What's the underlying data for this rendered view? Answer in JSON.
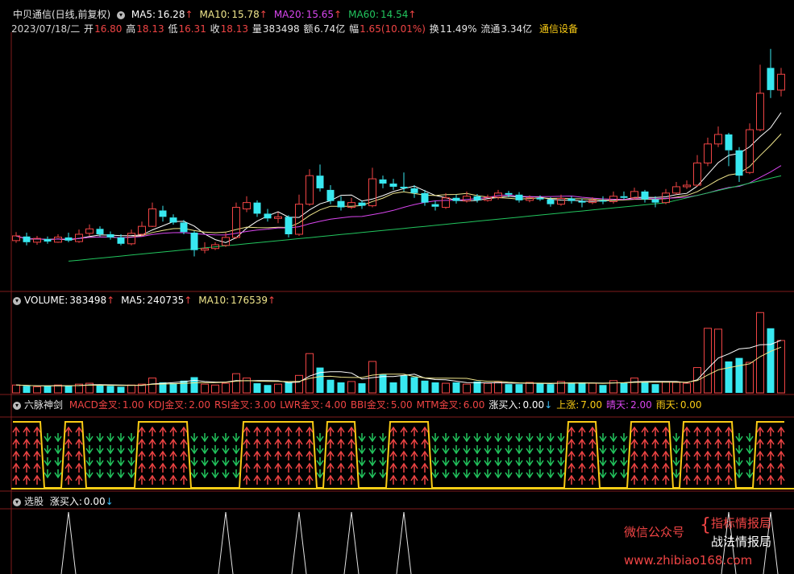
{
  "price_panel": {
    "title": "中贝通信(日线,前复权)",
    "ma": [
      {
        "label": "MA5:",
        "value": "16.28",
        "arrow": "↑",
        "color": "#ffffff"
      },
      {
        "label": "MA10:",
        "value": "15.78",
        "arrow": "↑",
        "color": "#f0e68c"
      },
      {
        "label": "MA20:",
        "value": "15.65",
        "arrow": "↑",
        "color": "#d946ef"
      },
      {
        "label": "MA60:",
        "value": "14.54",
        "arrow": "↑",
        "color": "#22c55e"
      }
    ],
    "info": {
      "date": "2023/07/18/二",
      "open_label": "开",
      "open": "16.80",
      "high_label": "高",
      "high": "18.13",
      "low_label": "低",
      "low": "16.31",
      "close_label": "收",
      "close": "18.13",
      "vol_label": "量",
      "vol": "383498",
      "amt_label": "额",
      "amt": "6.74亿",
      "chg_label": "幅",
      "chg": "1.65(10.01%)",
      "turn_label": "换",
      "turn": "11.49%",
      "float_label": "流通",
      "float": "3.34亿",
      "sector": "通信设备"
    }
  },
  "volume_panel": {
    "items": [
      {
        "label": "VOLUME:",
        "value": "383498",
        "arrow": "↑",
        "color": "#ffffff"
      },
      {
        "label": "MA5:",
        "value": "240735",
        "arrow": "↑",
        "color": "#ffffff"
      },
      {
        "label": "MA10:",
        "value": "176539",
        "arrow": "↑",
        "color": "#f0e68c"
      }
    ]
  },
  "indicator_panel": {
    "name": "六脉神剑",
    "items": [
      {
        "label": "MACD金叉:",
        "value": "1.00",
        "color": "#ef4444"
      },
      {
        "label": "KDJ金叉:",
        "value": "2.00",
        "color": "#ef4444"
      },
      {
        "label": "RSI金叉:",
        "value": "3.00",
        "color": "#ef4444"
      },
      {
        "label": "LWR金叉:",
        "value": "4.00",
        "color": "#ef4444"
      },
      {
        "label": "BBI金叉:",
        "value": "5.00",
        "color": "#ef4444"
      },
      {
        "label": "MTM金叉:",
        "value": "6.00",
        "color": "#ef4444"
      },
      {
        "label": "涨买入:",
        "value": "0.00",
        "arrow": "↓",
        "color": "#ffffff"
      },
      {
        "label": "上涨:",
        "value": "7.00",
        "color": "#facc15"
      },
      {
        "label": "晴天:",
        "value": "2.00",
        "color": "#d946ef"
      },
      {
        "label": "雨天:",
        "value": "0.00",
        "color": "#facc15"
      }
    ]
  },
  "select_panel": {
    "name": "选股",
    "items": [
      {
        "label": "涨买入:",
        "value": "0.00",
        "arrow": "↓",
        "color": "#ffffff"
      }
    ]
  },
  "watermark": {
    "line1": "微信公众号",
    "brand1": "指标情报局",
    "brand2": "战法情报局",
    "url": "www.zhibiao168.com"
  },
  "chart_data": {
    "type": "candlestick",
    "n_bars": 74,
    "candles": [
      {
        "o": 15.35,
        "c": 15.5,
        "h": 15.62,
        "l": 15.28
      },
      {
        "o": 15.48,
        "c": 15.3,
        "h": 15.6,
        "l": 15.2
      },
      {
        "o": 15.3,
        "c": 15.42,
        "h": 15.5,
        "l": 15.22
      },
      {
        "o": 15.4,
        "c": 15.32,
        "h": 15.48,
        "l": 15.25
      },
      {
        "o": 15.3,
        "c": 15.46,
        "h": 15.55,
        "l": 15.28
      },
      {
        "o": 15.45,
        "c": 15.35,
        "h": 15.6,
        "l": 15.3
      },
      {
        "o": 15.32,
        "c": 15.55,
        "h": 15.7,
        "l": 15.28
      },
      {
        "o": 15.58,
        "c": 15.72,
        "h": 15.86,
        "l": 15.5
      },
      {
        "o": 15.72,
        "c": 15.55,
        "h": 15.8,
        "l": 15.48
      },
      {
        "o": 15.55,
        "c": 15.45,
        "h": 15.64,
        "l": 15.38
      },
      {
        "o": 15.45,
        "c": 15.25,
        "h": 15.55,
        "l": 15.2
      },
      {
        "o": 15.25,
        "c": 15.58,
        "h": 15.7,
        "l": 15.2
      },
      {
        "o": 15.55,
        "c": 15.8,
        "h": 15.95,
        "l": 15.5
      },
      {
        "o": 15.8,
        "c": 16.35,
        "h": 16.55,
        "l": 15.78
      },
      {
        "o": 16.3,
        "c": 16.1,
        "h": 16.45,
        "l": 15.95
      },
      {
        "o": 16.08,
        "c": 15.92,
        "h": 16.18,
        "l": 15.85
      },
      {
        "o": 15.92,
        "c": 15.62,
        "h": 16.0,
        "l": 15.55
      },
      {
        "o": 15.6,
        "c": 15.05,
        "h": 15.65,
        "l": 14.85
      },
      {
        "o": 15.05,
        "c": 15.1,
        "h": 15.3,
        "l": 14.95
      },
      {
        "o": 15.1,
        "c": 15.22,
        "h": 15.3,
        "l": 15.05
      },
      {
        "o": 15.2,
        "c": 15.45,
        "h": 15.6,
        "l": 15.15
      },
      {
        "o": 15.45,
        "c": 16.4,
        "h": 16.55,
        "l": 15.4
      },
      {
        "o": 16.35,
        "c": 16.55,
        "h": 16.75,
        "l": 16.25
      },
      {
        "o": 16.55,
        "c": 16.2,
        "h": 16.62,
        "l": 16.1
      },
      {
        "o": 16.2,
        "c": 16.05,
        "h": 16.35,
        "l": 15.95
      },
      {
        "o": 16.05,
        "c": 16.1,
        "h": 16.25,
        "l": 15.9
      },
      {
        "o": 16.1,
        "c": 15.55,
        "h": 16.15,
        "l": 15.45
      },
      {
        "o": 15.55,
        "c": 16.5,
        "h": 16.8,
        "l": 15.5
      },
      {
        "o": 16.5,
        "c": 17.4,
        "h": 17.6,
        "l": 16.45
      },
      {
        "o": 17.4,
        "c": 17.0,
        "h": 17.75,
        "l": 16.9
      },
      {
        "o": 16.95,
        "c": 16.6,
        "h": 17.1,
        "l": 16.5
      },
      {
        "o": 16.6,
        "c": 16.4,
        "h": 16.75,
        "l": 16.3
      },
      {
        "o": 16.4,
        "c": 16.55,
        "h": 16.7,
        "l": 16.35
      },
      {
        "o": 16.55,
        "c": 16.45,
        "h": 16.62,
        "l": 16.35
      },
      {
        "o": 16.45,
        "c": 17.3,
        "h": 17.65,
        "l": 16.4
      },
      {
        "o": 17.28,
        "c": 17.15,
        "h": 17.4,
        "l": 17.0
      },
      {
        "o": 17.15,
        "c": 17.05,
        "h": 17.3,
        "l": 16.95
      },
      {
        "o": 17.05,
        "c": 17.0,
        "h": 17.5,
        "l": 16.9
      },
      {
        "o": 17.0,
        "c": 16.85,
        "h": 17.1,
        "l": 16.7
      },
      {
        "o": 16.85,
        "c": 16.55,
        "h": 16.95,
        "l": 16.45
      },
      {
        "o": 16.5,
        "c": 16.42,
        "h": 16.6,
        "l": 16.3
      },
      {
        "o": 16.4,
        "c": 16.7,
        "h": 16.85,
        "l": 16.35
      },
      {
        "o": 16.7,
        "c": 16.6,
        "h": 16.8,
        "l": 16.52
      },
      {
        "o": 16.6,
        "c": 16.75,
        "h": 16.9,
        "l": 16.55
      },
      {
        "o": 16.75,
        "c": 16.62,
        "h": 16.82,
        "l": 16.55
      },
      {
        "o": 16.62,
        "c": 16.72,
        "h": 16.8,
        "l": 16.58
      },
      {
        "o": 16.72,
        "c": 16.85,
        "h": 16.95,
        "l": 16.65
      },
      {
        "o": 16.85,
        "c": 16.8,
        "h": 16.92,
        "l": 16.72
      },
      {
        "o": 16.8,
        "c": 16.62,
        "h": 16.88,
        "l": 16.55
      },
      {
        "o": 16.62,
        "c": 16.7,
        "h": 16.78,
        "l": 16.56
      },
      {
        "o": 16.7,
        "c": 16.65,
        "h": 16.78,
        "l": 16.6
      },
      {
        "o": 16.65,
        "c": 16.5,
        "h": 16.72,
        "l": 16.42
      },
      {
        "o": 16.5,
        "c": 16.68,
        "h": 16.8,
        "l": 16.45
      },
      {
        "o": 16.68,
        "c": 16.6,
        "h": 16.75,
        "l": 16.52
      },
      {
        "o": 16.6,
        "c": 16.55,
        "h": 16.68,
        "l": 16.4
      },
      {
        "o": 16.55,
        "c": 16.62,
        "h": 16.72,
        "l": 16.5
      },
      {
        "o": 16.62,
        "c": 16.58,
        "h": 16.75,
        "l": 16.5
      },
      {
        "o": 16.58,
        "c": 16.75,
        "h": 16.9,
        "l": 16.52
      },
      {
        "o": 16.75,
        "c": 16.7,
        "h": 16.9,
        "l": 16.65
      },
      {
        "o": 16.7,
        "c": 16.9,
        "h": 17.02,
        "l": 16.65
      },
      {
        "o": 16.9,
        "c": 16.65,
        "h": 16.95,
        "l": 16.55
      },
      {
        "o": 16.65,
        "c": 16.55,
        "h": 16.75,
        "l": 16.4
      },
      {
        "o": 16.55,
        "c": 16.85,
        "h": 16.98,
        "l": 16.5
      },
      {
        "o": 16.85,
        "c": 17.05,
        "h": 17.2,
        "l": 16.8
      },
      {
        "o": 17.05,
        "c": 17.1,
        "h": 17.25,
        "l": 16.98
      },
      {
        "o": 17.1,
        "c": 17.8,
        "h": 18.05,
        "l": 17.05
      },
      {
        "o": 17.8,
        "c": 18.4,
        "h": 18.6,
        "l": 17.7
      },
      {
        "o": 18.4,
        "c": 18.7,
        "h": 18.95,
        "l": 18.3
      },
      {
        "o": 18.7,
        "c": 18.2,
        "h": 18.75,
        "l": 17.7
      },
      {
        "o": 18.2,
        "c": 17.4,
        "h": 18.3,
        "l": 17.2
      },
      {
        "o": 17.5,
        "c": 18.85,
        "h": 19.05,
        "l": 17.45
      },
      {
        "o": 18.85,
        "c": 20.0,
        "h": 20.9,
        "l": 18.8
      },
      {
        "o": 20.8,
        "c": 20.1,
        "h": 21.4,
        "l": 19.85
      },
      {
        "o": 20.1,
        "c": 20.6,
        "h": 20.8,
        "l": 19.9
      }
    ],
    "volume": [
      9,
      8,
      7,
      8,
      9,
      8,
      10,
      11,
      9,
      8,
      7,
      9,
      10,
      17,
      12,
      11,
      14,
      18,
      10,
      9,
      11,
      22,
      17,
      11,
      9,
      10,
      12,
      20,
      45,
      29,
      15,
      12,
      13,
      11,
      36,
      21,
      12,
      20,
      18,
      14,
      12,
      11,
      12,
      10,
      13,
      11,
      12,
      10,
      10,
      12,
      11,
      10,
      13,
      11,
      12,
      11,
      9,
      14,
      12,
      17,
      13,
      10,
      13,
      12,
      11,
      29,
      74,
      73,
      36,
      40,
      35,
      92,
      74,
      60
    ],
    "ma_series": [
      {
        "name": "MA5",
        "color": "#ffffff"
      },
      {
        "name": "MA10",
        "color": "#f0e68c"
      },
      {
        "name": "MA20",
        "color": "#d946ef"
      },
      {
        "name": "MA60",
        "color": "#22c55e"
      }
    ],
    "up_candle_color": "#ef4444",
    "down_candle_color": "#38e8f0",
    "six_signal_state": [
      1,
      1,
      1,
      0,
      0,
      1,
      1,
      0,
      0,
      0,
      0,
      0,
      1,
      1,
      1,
      1,
      1,
      0,
      0,
      0,
      0,
      0,
      1,
      1,
      1,
      1,
      1,
      1,
      1,
      0,
      1,
      1,
      1,
      0,
      0,
      0,
      1,
      1,
      1,
      1,
      0,
      0,
      0,
      0,
      0,
      0,
      0,
      0,
      0,
      0,
      0,
      0,
      0,
      1,
      1,
      1,
      0,
      0,
      0,
      1,
      1,
      1,
      1,
      0,
      1,
      1,
      1,
      1,
      1,
      0,
      0,
      1,
      1,
      1
    ],
    "select_signal": [
      0,
      0,
      0,
      0,
      0,
      1,
      0,
      0,
      0,
      0,
      0,
      0,
      0,
      0,
      0,
      0,
      0,
      0,
      0,
      0,
      1,
      0,
      0,
      0,
      0,
      0,
      0,
      1,
      0,
      0,
      0,
      0,
      1,
      0,
      0,
      0,
      0,
      1,
      0,
      0,
      0,
      0,
      0,
      0,
      0,
      0,
      0,
      0,
      0,
      0,
      0,
      0,
      0,
      0,
      0,
      0,
      0,
      0,
      0,
      0,
      0,
      0,
      0,
      0,
      0,
      0,
      0,
      0,
      1,
      0,
      0,
      0,
      1,
      0
    ]
  }
}
